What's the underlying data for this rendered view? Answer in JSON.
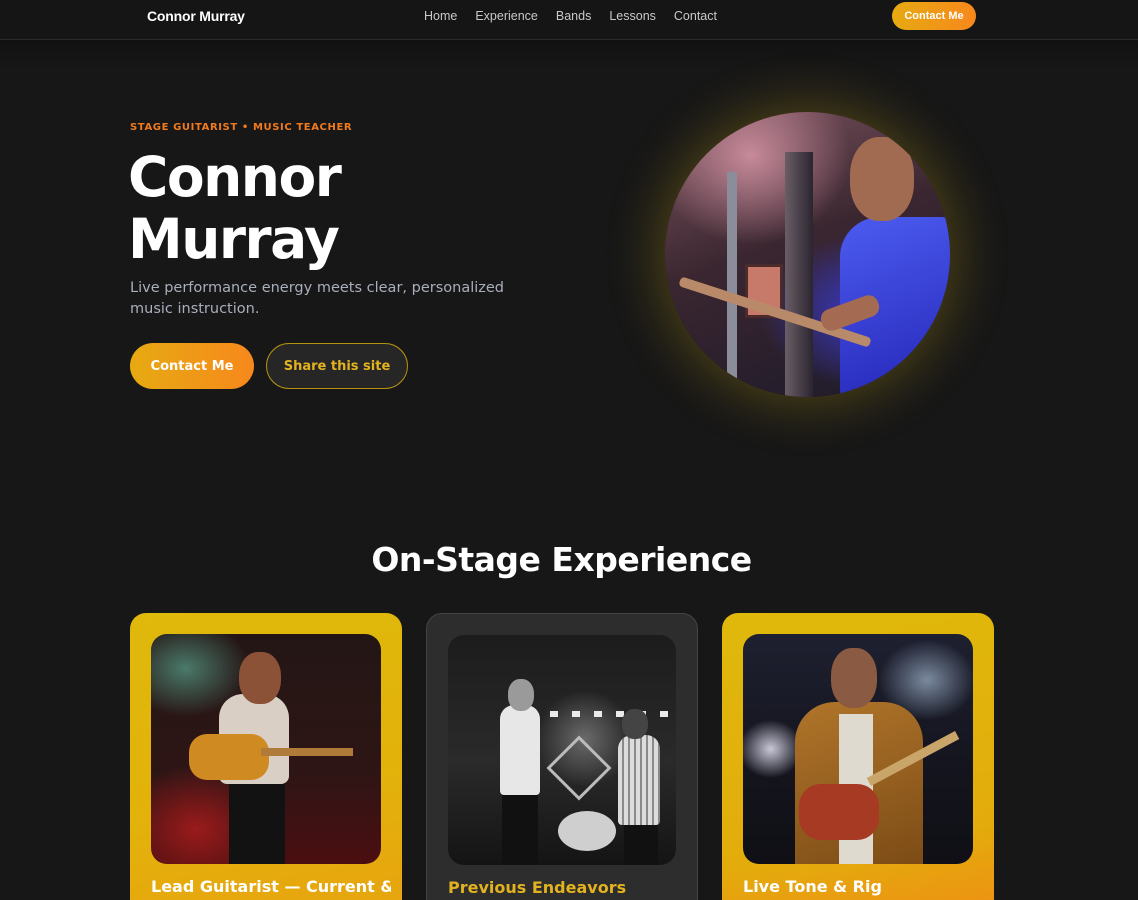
{
  "nav": {
    "brand": "Connor Murray",
    "links": [
      "Home",
      "Experience",
      "Bands",
      "Lessons",
      "Contact"
    ],
    "cta": "Contact Me"
  },
  "hero": {
    "eyebrow": "STAGE GUITARIST • MUSIC TEACHER",
    "title_line1": "Connor",
    "title_line2": "Murray",
    "subtitle": "Live performance energy meets clear, personalized music instruction.",
    "primary_button": "Contact Me",
    "secondary_button": "Share this site"
  },
  "experience": {
    "title": "On-Stage Experience",
    "cards": [
      {
        "title": "Lead Guitarist — Current & "
      },
      {
        "title": "Previous Endeavors"
      },
      {
        "title": "Live Tone & Rig"
      }
    ]
  },
  "colors": {
    "background": "#171717",
    "accent_gold": "#e6aa12",
    "accent_orange": "#f7881c",
    "eyebrow": "#f07a1c"
  }
}
